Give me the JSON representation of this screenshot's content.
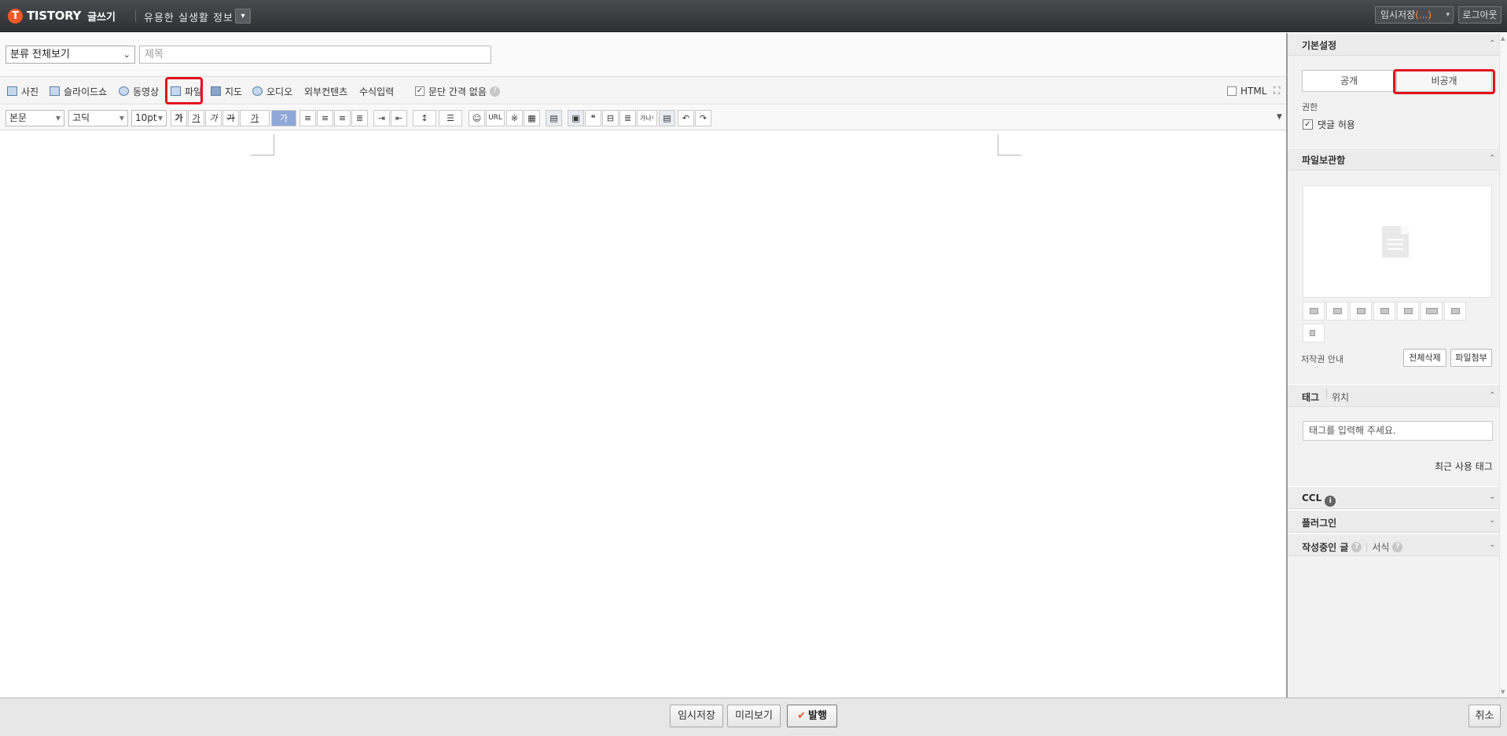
{
  "topbar": {
    "logo_letter": "T",
    "logo_text": "TISTORY",
    "logo_sub": "글쓰기",
    "blog_name": "유용한 실생활 정보",
    "blog_dropdown_icon": "chevron-down-icon",
    "temp_save_label": "임시저장",
    "temp_save_count": "(...)",
    "logout_label": "로그아웃"
  },
  "title_row": {
    "category_value": "분류 전체보기",
    "title_placeholder": "제목"
  },
  "toolbar1": {
    "photo": "사진",
    "slideshow": "슬라이드쇼",
    "video": "동영상",
    "file": "파일",
    "map": "지도",
    "audio": "오디오",
    "external": "외부컨텐츠",
    "formula": "수식입력",
    "no_paragraph_gap": "문단 간격 없음",
    "html": "HTML"
  },
  "toolbar2": {
    "paragraph_style": "본문",
    "font": "고딕",
    "font_size": "10pt",
    "bold": "가",
    "underline": "가",
    "italic": "가",
    "strike": "가",
    "font_color": "가",
    "bg_color": "가",
    "url": "URL",
    "quote": "❝",
    "superscript": "가나¹"
  },
  "sidebar": {
    "basic_settings": {
      "title": "기본설정",
      "public_label": "공개",
      "private_label": "비공개",
      "permission_label": "권한",
      "allow_comments": "댓글 허용"
    },
    "file_storage": {
      "title": "파일보관함",
      "copyright": "저작권 안내",
      "delete_all": "전체삭제",
      "attach_file": "파일첨부"
    },
    "tags": {
      "title": "태그",
      "location": "위치",
      "input_placeholder": "태그를 입력해 주세요.",
      "recent_tags": "최근 사용 태그"
    },
    "ccl": {
      "title": "CCL"
    },
    "plugin": {
      "title": "플러그인"
    },
    "drafts": {
      "title": "작성중인 글",
      "format": "서식"
    }
  },
  "bottombar": {
    "temp_save": "임시저장",
    "preview": "미리보기",
    "publish": "발행",
    "cancel": "취소"
  },
  "colors": {
    "topbar": "#3a3b3f",
    "brand_orange": "#f05a28",
    "highlight_red": "#e0141d"
  }
}
